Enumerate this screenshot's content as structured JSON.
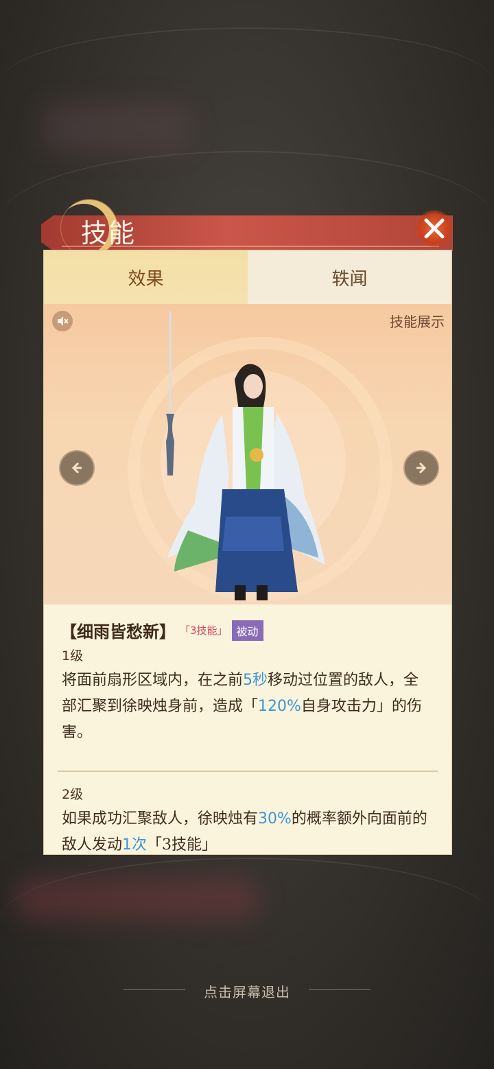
{
  "dialog": {
    "title": "技能",
    "close_icon": "close-icon"
  },
  "tabs": [
    {
      "label": "效果",
      "active": true
    },
    {
      "label": "轶闻",
      "active": false
    }
  ],
  "showcase": {
    "label": "技能展示",
    "mute_icon": "speaker-muted-icon",
    "prev_icon": "arrow-left-icon",
    "next_icon": "arrow-right-icon"
  },
  "skill": {
    "name": "【细雨皆愁新】",
    "slot_tag": "「3技能」",
    "type_tag": "被动",
    "levels": [
      {
        "label": "1级",
        "parts": [
          "将面前扇形区域内，在之前",
          "5秒",
          "移动过位置的敌人，全部汇聚到徐映烛身前，造成「",
          "120%",
          "自身攻击力」的伤害。"
        ]
      },
      {
        "label": "2级",
        "parts": [
          "如果成功汇聚敌人，徐映烛有",
          "30%",
          "的概率额外向面前的敌人发动",
          "1次",
          "「3技能」"
        ]
      }
    ]
  },
  "footer": {
    "exit_hint": "点击屏幕退出"
  },
  "colors": {
    "highlight": "#3d95d6",
    "title_bar": "#b24538",
    "type_tag_bg": "#8a6bb8"
  }
}
